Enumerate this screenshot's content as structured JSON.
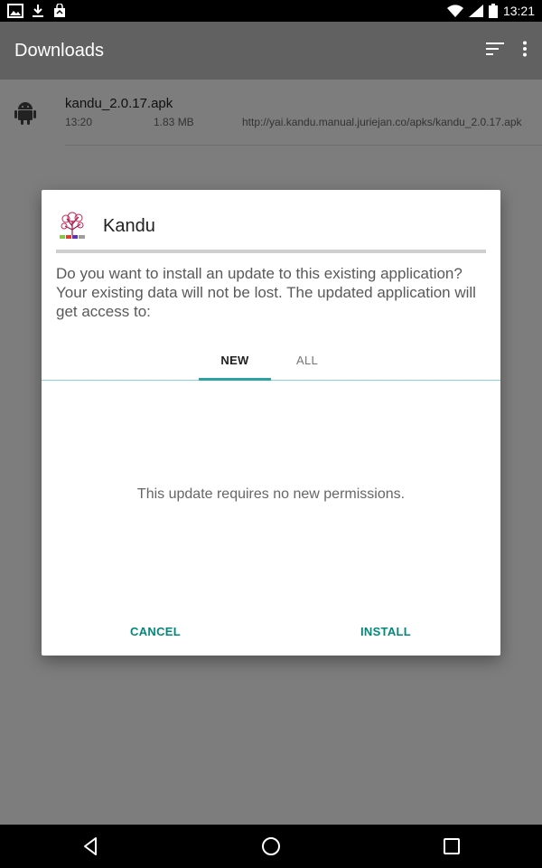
{
  "status_bar": {
    "time": "13:21",
    "icons": [
      "image-icon",
      "download-icon",
      "store-icon",
      "wifi-icon",
      "signal-icon",
      "battery-icon"
    ]
  },
  "app_bar": {
    "title": "Downloads",
    "actions": [
      "sort-icon",
      "more-vert-icon"
    ]
  },
  "download": {
    "file_name": "kandu_2.0.17.apk",
    "time": "13:20",
    "size": "1.83 MB",
    "url": "http://yai.kandu.manual.juriejan.co/apks/kandu_2.0.17.apk",
    "icon": "android-icon"
  },
  "dialog": {
    "app_name": "Kandu",
    "app_icon": "kandu-logo-icon",
    "message": "Do you want to install an update to this existing application? Your existing data will not be lost. The updated application will get access to:",
    "tabs": [
      {
        "label": "NEW",
        "selected": true
      },
      {
        "label": "ALL",
        "selected": false
      }
    ],
    "permissions_message": "This update requires no new permissions.",
    "cancel_label": "CANCEL",
    "install_label": "INSTALL",
    "accent_color": "#00897b"
  },
  "nav_bar": {
    "items": [
      "back-icon",
      "home-icon",
      "recents-icon"
    ]
  }
}
